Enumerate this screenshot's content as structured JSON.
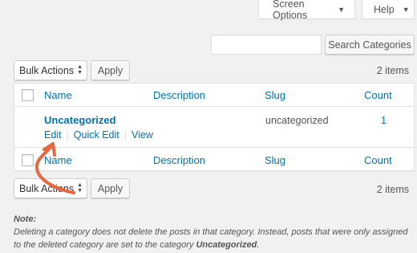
{
  "top_tabs": {
    "screen_options": "Screen Options",
    "help": "Help"
  },
  "search": {
    "input_value": "",
    "button_label": "Search Categories"
  },
  "bulk_top": {
    "select_value": "Bulk Actions",
    "apply_label": "Apply",
    "items_count": "2 items"
  },
  "table": {
    "columns": {
      "name": "Name",
      "description": "Description",
      "slug": "Slug",
      "count": "Count"
    },
    "rows": [
      {
        "name": "Uncategorized",
        "description": "",
        "slug": "uncategorized",
        "count": "1",
        "actions": [
          "Edit",
          "Quick Edit",
          "View"
        ]
      }
    ]
  },
  "bulk_bottom": {
    "select_value": "Bulk Actions",
    "apply_label": "Apply",
    "items_count": "2 items"
  },
  "note": {
    "title": "Note:",
    "text_before": "Deleting a category does not delete the posts in that category. Instead, posts that were only assigned to the deleted category are set to the category ",
    "bold_term": "Uncategorized",
    "text_after": "."
  },
  "colors": {
    "background": "#f1f1f1",
    "link": "#0073aa",
    "annotation_arrow": "#e8663d"
  }
}
